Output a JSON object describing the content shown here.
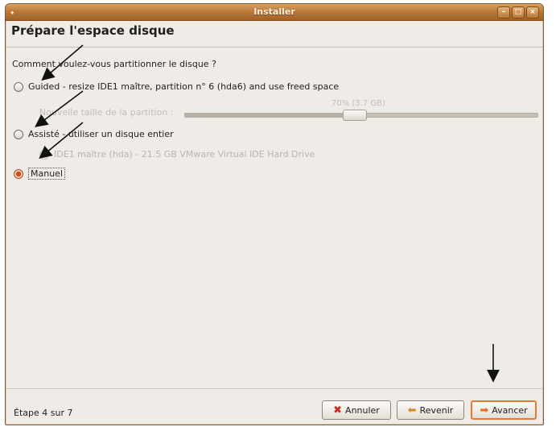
{
  "window": {
    "title": "Installer",
    "buttons": [
      "minimize",
      "maximize",
      "close"
    ]
  },
  "header": {
    "title": "Prépare l'espace disque"
  },
  "question": "Comment voulez-vous partitionner le disque ?",
  "options": [
    {
      "label": "Guided - resize IDE1 maître, partition n° 6 (hda6) and use freed space",
      "selected": false,
      "enabled": true
    },
    {
      "label": "Assisté - utiliser un disque entier",
      "selected": false,
      "enabled": true
    },
    {
      "label": "IDE1 maître (hda) - 21.5 GB VMware Virtual IDE Hard Drive",
      "selected": true,
      "enabled": false
    },
    {
      "label": "Manuel",
      "selected": true,
      "enabled": true
    }
  ],
  "slider": {
    "label": "Nouvelle taille de la partition :",
    "value_text": "70% (3.7 GB)",
    "value_fraction": 0.48
  },
  "footer": {
    "step_text": "Étape 4 sur 7",
    "cancel_label": "Annuler",
    "back_label": "Revenir",
    "next_label": "Avancer"
  },
  "icons": {
    "cancel": "red-x-icon",
    "back": "left-arrow-icon",
    "next": "right-arrow-icon"
  },
  "colors": {
    "titlebar": "#b97a3b",
    "selected_radio": "#d64d18",
    "focus_button": "#e17b3a"
  }
}
